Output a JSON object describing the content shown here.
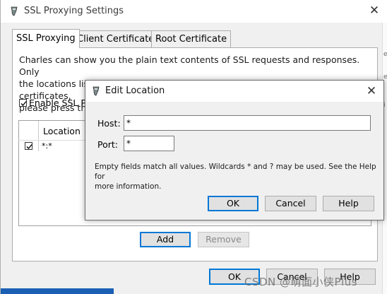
{
  "main_window": {
    "title": "SSL Proxying Settings",
    "tabs": [
      {
        "label": "SSL Proxying"
      },
      {
        "label": "Client Certificates"
      },
      {
        "label": "Root Certificate"
      }
    ],
    "description_lines": [
      "Charles can show you the plain text contents of SSL requests and responses. Only",
      "the locations listed below will be proxied. Charles will issue and sign SSL certificates,",
      "please press the"
    ],
    "enable_label": "Enable SSL Pr",
    "table": {
      "header": "Location",
      "rows": [
        {
          "checked": true,
          "location": "*:*"
        }
      ]
    },
    "add_label": "Add",
    "remove_label": "Remove",
    "ok_label": "OK",
    "cancel_label": "Cancel",
    "help_label": "Help"
  },
  "dialog": {
    "title": "Edit Location",
    "host_label": "Host:",
    "host_value": "*",
    "port_label": "Port:",
    "port_value": "*",
    "note_lines": [
      "Empty fields match all values. Wildcards * and ? may be used. See the Help for",
      "more information."
    ],
    "ok_label": "OK",
    "cancel_label": "Cancel",
    "help_label": "Help"
  },
  "watermark": "CSDN @萌面小侠Plus"
}
